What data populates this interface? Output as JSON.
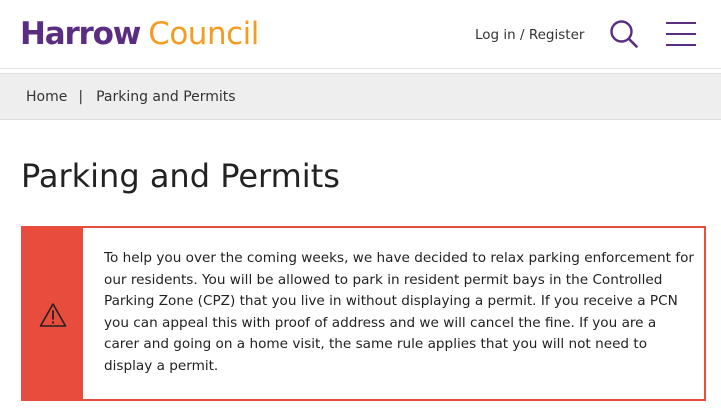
{
  "header": {
    "logo_word1": "Harrow",
    "logo_word2": "Council",
    "login_label": "Log in / Register",
    "search_icon": "search-icon",
    "menu_icon": "hamburger-menu-icon"
  },
  "breadcrumb": {
    "home": "Home",
    "separator": "|",
    "current": "Parking and Permits"
  },
  "page": {
    "title": "Parking and Permits"
  },
  "alert": {
    "icon": "warning-icon",
    "text": "To help you over the coming weeks, we have decided to relax parking enforcement for our residents. You will be allowed to park in resident permit bays in the Controlled Parking Zone (CPZ) that you live in without displaying a permit. If you receive a PCN you can appeal this with proof of address and we will cancel the fine. If you are a carer and going on a home visit, the same rule applies that you will not need to display a permit."
  },
  "colors": {
    "brand_purple": "#5a2d82",
    "brand_orange": "#f39c21",
    "alert_red": "#e74c3c",
    "breadcrumb_bg": "#eeeeee"
  }
}
